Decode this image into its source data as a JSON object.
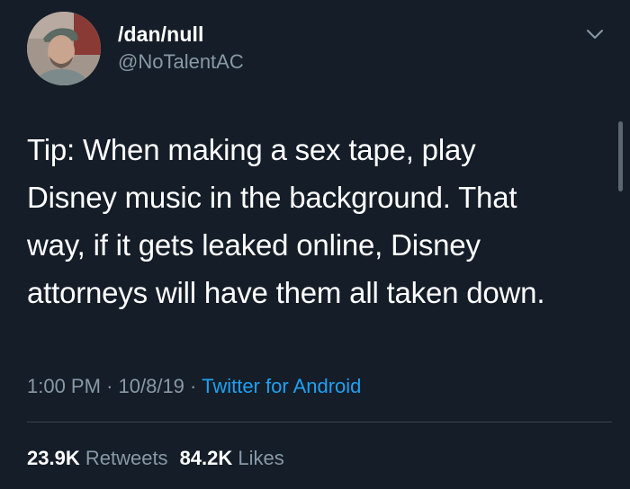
{
  "author": {
    "display_name": "/dan/null",
    "handle": "@NoTalentAC",
    "avatar_icon": "user-avatar-photo"
  },
  "tweet": {
    "lines": [
      "Tip: When making a sex tape, play",
      "Disney music in the background. That",
      "way, if it gets leaked online, Disney",
      "attorneys will have them all taken down."
    ]
  },
  "meta": {
    "time": "1:00 PM",
    "separator": "·",
    "date": "10/8/19",
    "source": "Twitter for Android"
  },
  "stats": {
    "retweets_count": "23.9K",
    "retweets_label": "Retweets",
    "likes_count": "84.2K",
    "likes_label": "Likes"
  },
  "colors": {
    "background": "#151d28",
    "text": "#ffffff",
    "muted": "#8899a6",
    "link": "#1da1f2",
    "divider": "#38444d"
  },
  "icons": {
    "menu": "chevron-down-icon"
  }
}
